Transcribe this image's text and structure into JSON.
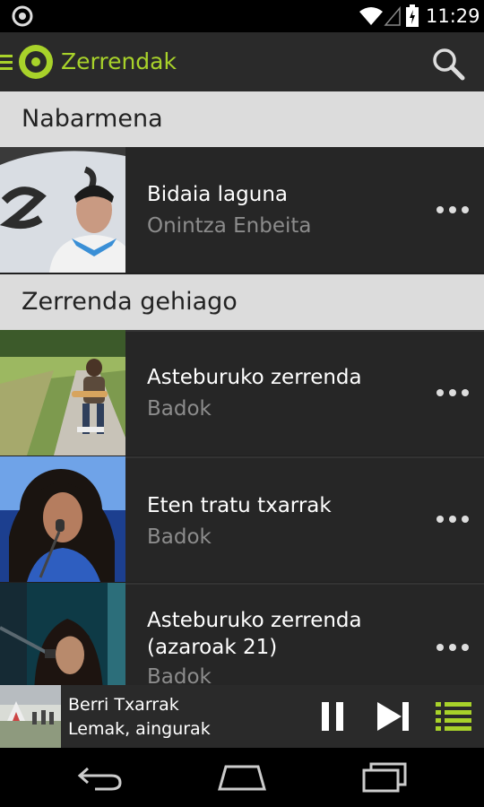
{
  "status_bar": {
    "time": "11:29",
    "icons": [
      "notification-icon",
      "wifi-icon",
      "signal-icon",
      "battery-charging-icon"
    ]
  },
  "action_bar": {
    "title": "Zerrendak",
    "icons": [
      "drawer-menu-icon",
      "app-logo-icon",
      "search-icon"
    ],
    "accent_color": "#a8d22a"
  },
  "sections": [
    {
      "header": "Nabarmena",
      "items": [
        {
          "title": "Bidaia laguna",
          "subtitle": "Onintza Enbeita"
        }
      ]
    },
    {
      "header": "Zerrenda gehiago",
      "items": [
        {
          "title": "Asteburuko zerrenda",
          "subtitle": "Badok"
        },
        {
          "title": "Eten tratu txarrak",
          "subtitle": "Badok"
        },
        {
          "title": "Asteburuko zerrenda (azaroak 21)",
          "subtitle": "Badok"
        }
      ]
    }
  ],
  "now_playing": {
    "artist": "Berri Txarrak",
    "track": "Lemak, aingurak",
    "icons": [
      "pause-icon",
      "skip-next-icon",
      "queue-icon"
    ]
  },
  "nav_bar": {
    "icons": [
      "back-icon",
      "home-icon",
      "recent-apps-icon"
    ]
  },
  "colors": {
    "accent": "#a8d22a",
    "section_header_bg": "#dcdcdc",
    "row_bg": "#262626",
    "subtitle": "#8c8c8c"
  }
}
